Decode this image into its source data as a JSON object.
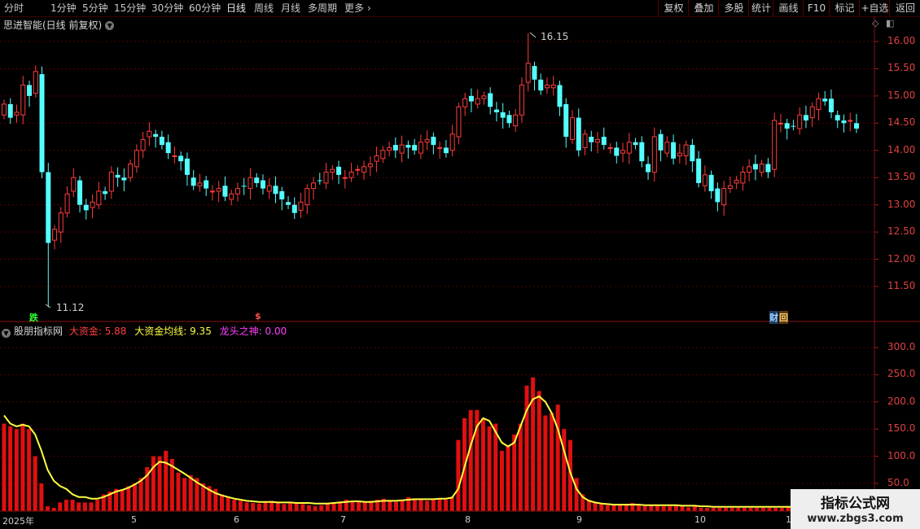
{
  "toolbar": {
    "timeframes": [
      "分时",
      "1分钟",
      "5分钟",
      "15分钟",
      "30分钟",
      "60分钟",
      "日线",
      "周线",
      "月线",
      "多周期",
      "更多"
    ],
    "more_arrow": "›",
    "right_buttons": [
      "复权",
      "叠加",
      "多股",
      "统计",
      "画线",
      "F10",
      "标记",
      "+自选",
      "返回"
    ]
  },
  "main_chart": {
    "title": "思进智能(日线 前复权)",
    "title_dropdown_icon": "chevron-down-icon",
    "top_right_icons": [
      "diamond-icon",
      "collapse-icon"
    ],
    "price_axis": [
      "16.00",
      "15.50",
      "15.00",
      "14.50",
      "14.00",
      "13.50",
      "13.00",
      "12.50",
      "12.00",
      "11.50"
    ],
    "high_label": "16.15",
    "low_label": "11.12",
    "markers": {
      "die": "跌",
      "dollar": "$",
      "cai": "财",
      "hui": "回"
    },
    "colors": {
      "up": "#ff3c3c",
      "down": "#54ffff",
      "grid": "#5a0000",
      "axis_text": "#e04040"
    }
  },
  "sub_chart": {
    "name": "股朋指标网",
    "series": [
      {
        "label": "大资金: 5.88",
        "color": "#ff4040"
      },
      {
        "label": "大资金均线: 9.35",
        "color": "#ffff40"
      },
      {
        "label": "龙头之神: 0.00",
        "color": "#ff40ff"
      }
    ],
    "value_axis": [
      "300.0",
      "250.0",
      "200.0",
      "150.0",
      "100.0",
      "50.0"
    ]
  },
  "dates": [
    "2025年",
    "5",
    "6",
    "7",
    "8",
    "9",
    "10",
    "1"
  ],
  "watermark": {
    "title": "指标公式网",
    "url": "www.zbgs3.com"
  },
  "chart_data": [
    {
      "type": "candlestick",
      "title": "思进智能(日线 前复权)",
      "ylim": [
        11.12,
        16.15
      ],
      "y_ticks": [
        11.5,
        12.0,
        12.5,
        13.0,
        13.5,
        14.0,
        14.5,
        15.0,
        15.5,
        16.0
      ],
      "x_ticks": [
        "2025年",
        "5",
        "6",
        "7",
        "8",
        "9",
        "10",
        "1"
      ],
      "annotations": [
        {
          "text": "16.15",
          "type": "max"
        },
        {
          "text": "11.12",
          "type": "min"
        }
      ],
      "closes": [
        14.85,
        14.6,
        14.7,
        15.2,
        15.0,
        15.45,
        13.6,
        12.3,
        12.55,
        12.85,
        13.2,
        13.5,
        13.0,
        12.9,
        13.05,
        13.25,
        13.2,
        13.6,
        13.5,
        13.45,
        13.75,
        14.0,
        14.2,
        14.35,
        14.25,
        14.1,
        13.95,
        13.9,
        13.8,
        13.55,
        13.35,
        13.4,
        13.3,
        13.25,
        13.3,
        13.15,
        13.2,
        13.3,
        13.35,
        13.5,
        13.4,
        13.3,
        13.35,
        13.2,
        13.1,
        13.0,
        12.85,
        13.05,
        13.3,
        13.4,
        13.45,
        13.6,
        13.65,
        13.55,
        13.5,
        13.6,
        13.65,
        13.7,
        13.75,
        13.9,
        14.0,
        14.05,
        14.0,
        14.1,
        14.05,
        14.0,
        14.15,
        14.2,
        14.1,
        14.05,
        13.95,
        14.3,
        14.8,
        14.95,
        14.9,
        14.95,
        15.0,
        14.8,
        14.7,
        14.6,
        14.5,
        14.65,
        15.2,
        15.6,
        15.3,
        15.1,
        15.2,
        15.2,
        14.8,
        14.25,
        14.6,
        14.0,
        14.3,
        14.15,
        14.2,
        14.1,
        14.05,
        13.9,
        14.0,
        14.15,
        14.1,
        13.8,
        13.6,
        14.25,
        14.0,
        14.15,
        13.85,
        13.95,
        14.1,
        13.8,
        13.4,
        13.55,
        13.25,
        13.05,
        13.3,
        13.35,
        13.45,
        13.6,
        13.7,
        13.65,
        13.75,
        13.6,
        14.55,
        14.5,
        14.4,
        14.45,
        14.65,
        14.55,
        14.8,
        14.95,
        14.9,
        14.7,
        14.55,
        14.5,
        14.55,
        14.4
      ]
    },
    {
      "type": "bar_line",
      "title": "股朋指标网",
      "ylim": [
        0,
        330
      ],
      "y_ticks": [
        50,
        100,
        150,
        200,
        250,
        300
      ],
      "series_names": [
        "大资金",
        "大资金均线",
        "龙头之神"
      ],
      "last_values": {
        "大资金": 5.88,
        "大资金均线": 9.35,
        "龙头之神": 0.0
      },
      "bars": [
        160,
        155,
        150,
        160,
        150,
        100,
        50,
        8,
        5,
        15,
        20,
        20,
        15,
        15,
        15,
        20,
        30,
        35,
        40,
        38,
        45,
        50,
        60,
        80,
        100,
        100,
        110,
        95,
        70,
        60,
        65,
        60,
        50,
        45,
        40,
        30,
        25,
        20,
        18,
        15,
        14,
        13,
        15,
        18,
        14,
        12,
        15,
        14,
        12,
        10,
        8,
        10,
        12,
        15,
        17,
        20,
        18,
        16,
        15,
        18,
        20,
        22,
        18,
        16,
        20,
        25,
        22,
        20,
        18,
        20,
        22,
        20,
        25,
        130,
        170,
        185,
        185,
        170,
        155,
        160,
        110,
        120,
        140,
        160,
        230,
        245,
        220,
        175,
        180,
        195,
        150,
        130,
        60,
        30,
        20,
        15,
        12,
        10,
        10,
        10,
        12,
        14,
        10,
        8,
        10,
        10,
        8,
        8,
        10,
        8,
        6,
        8,
        5,
        5,
        5,
        5,
        5,
        5,
        5,
        5,
        5,
        5,
        5,
        5,
        5,
        5,
        6,
        7,
        8,
        10,
        12,
        8,
        9,
        9,
        8,
        6,
        6,
        6
      ],
      "ma": [
        175,
        160,
        155,
        158,
        155,
        140,
        110,
        75,
        55,
        45,
        40,
        30,
        25,
        25,
        22,
        22,
        25,
        30,
        35,
        38,
        42,
        48,
        55,
        65,
        80,
        90,
        88,
        82,
        75,
        68,
        60,
        52,
        45,
        38,
        32,
        28,
        25,
        22,
        20,
        18,
        17,
        16,
        16,
        16,
        15,
        15,
        15,
        14,
        14,
        14,
        13,
        13,
        13,
        14,
        15,
        16,
        17,
        17,
        16,
        16,
        17,
        18,
        18,
        18,
        19,
        20,
        21,
        21,
        21,
        21,
        22,
        22,
        24,
        40,
        80,
        120,
        155,
        170,
        165,
        145,
        125,
        118,
        125,
        155,
        185,
        205,
        210,
        200,
        180,
        150,
        110,
        70,
        40,
        25,
        18,
        15,
        13,
        12,
        11,
        11,
        11,
        11,
        11,
        10,
        10,
        10,
        10,
        10,
        10,
        9,
        9,
        9,
        8,
        8,
        7,
        7,
        7,
        7,
        7,
        7,
        7,
        7,
        7,
        7,
        7,
        7,
        7,
        7,
        7,
        7,
        8,
        8,
        8,
        9,
        9,
        9,
        9,
        9
      ]
    }
  ]
}
